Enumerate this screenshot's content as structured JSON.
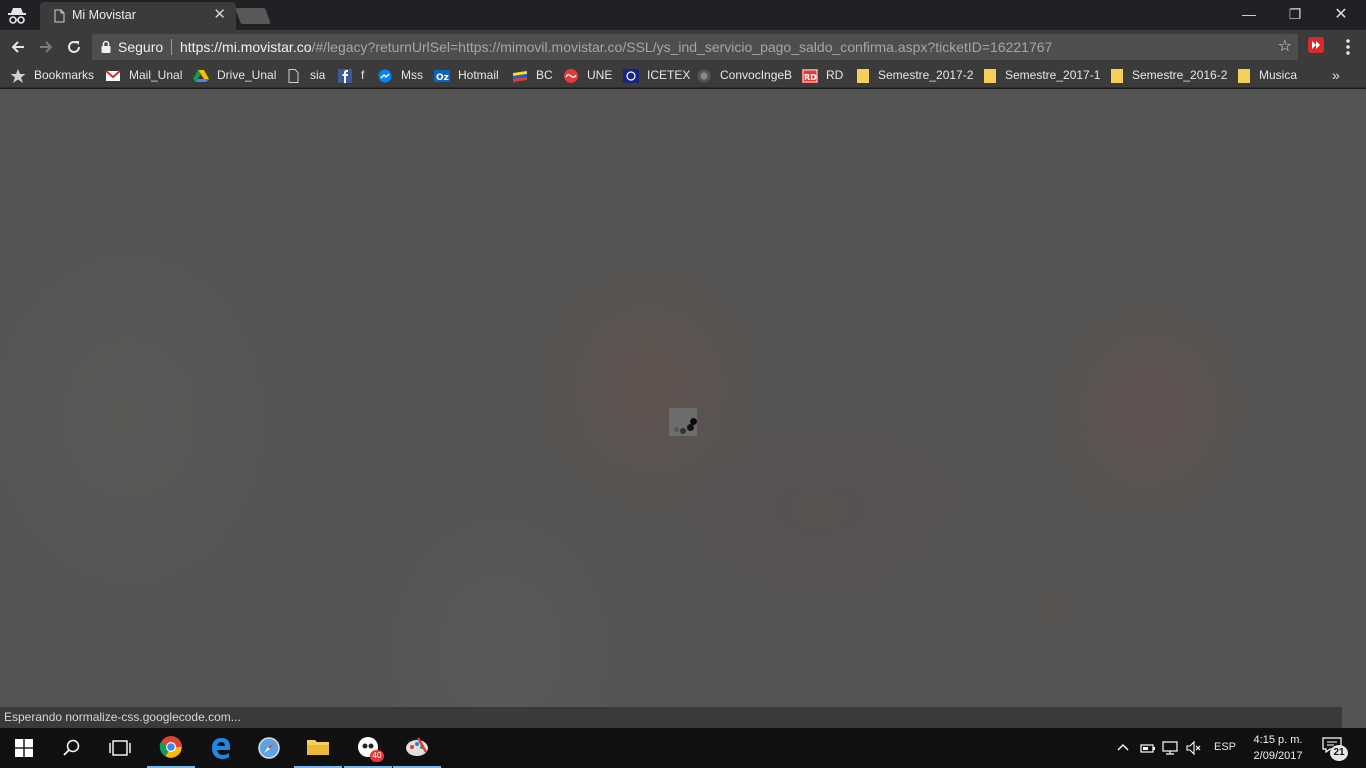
{
  "browser": {
    "tab": {
      "title": "Mi Movistar",
      "icon": "file-icon",
      "close": "✕"
    },
    "window_buttons": {
      "minimize": "—",
      "maximize": "❐",
      "close": "✕"
    },
    "omnibox": {
      "secure_label": "Seguro",
      "url_scheme": "https://",
      "url_host": "mi.movistar.co",
      "url_rest": "/#/legacy?returnUrlSel=https://mimovil.movistar.co/SSL/ys_ind_servicio_pago_saldo_confirma.aspx?ticketID=16221767"
    }
  },
  "bookmarks": {
    "items": [
      {
        "label": "Bookmarks",
        "icon": "star-icon"
      },
      {
        "label": "Mail_Unal",
        "icon": "gmail-icon"
      },
      {
        "label": "Drive_Unal",
        "icon": "drive-icon"
      },
      {
        "label": "sia",
        "icon": "file-icon"
      },
      {
        "label": "f",
        "icon": "facebook-icon"
      },
      {
        "label": "Mss",
        "icon": "messenger-icon"
      },
      {
        "label": "Hotmail",
        "icon": "outlook-icon"
      },
      {
        "label": "BC",
        "icon": "bancolombia-icon"
      },
      {
        "label": "UNE",
        "icon": "une-icon"
      },
      {
        "label": "ICETEX",
        "icon": "icetex-icon"
      },
      {
        "label": "ConvocIngeB",
        "icon": "seal-icon"
      },
      {
        "label": "RD",
        "icon": "rd-icon"
      },
      {
        "label": "Semestre_2017-2",
        "icon": "folder-icon"
      },
      {
        "label": "Semestre_2017-1",
        "icon": "folder-icon"
      },
      {
        "label": "Semestre_2016-2",
        "icon": "folder-icon"
      },
      {
        "label": "Musica",
        "icon": "folder-icon"
      }
    ],
    "more": "»"
  },
  "page": {
    "status_text": "Esperando normalize-css.googlecode.com..."
  },
  "taskbar": {
    "app_badge": "40",
    "language": "ESP",
    "time": "4:15 p. m.",
    "date": "2/09/2017",
    "notification_count": "21"
  },
  "colors": {
    "titlebar": "#202124",
    "toolbar": "#3b3b3b",
    "omnibox": "#4e4e4e",
    "taskbar": "#101010",
    "accent": "#76b9ed"
  }
}
